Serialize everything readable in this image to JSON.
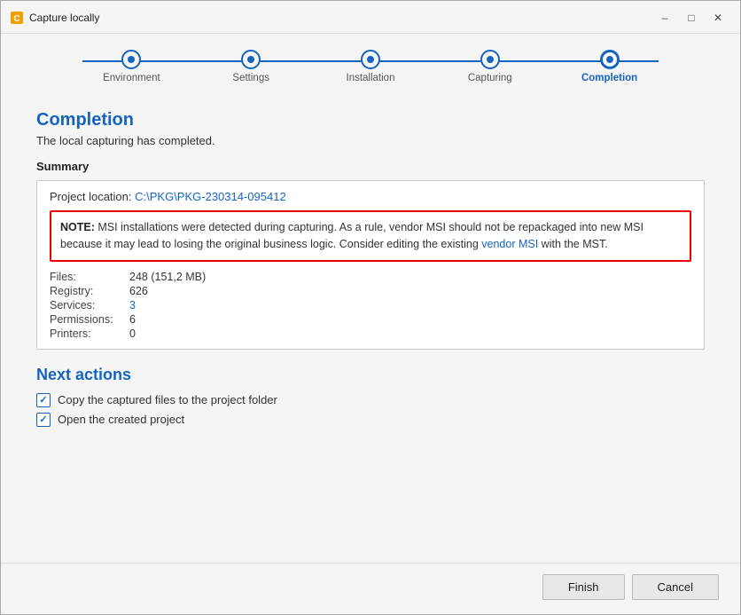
{
  "window": {
    "title": "Capture locally"
  },
  "stepper": {
    "steps": [
      {
        "label": "Environment",
        "active": false
      },
      {
        "label": "Settings",
        "active": false
      },
      {
        "label": "Installation",
        "active": false
      },
      {
        "label": "Capturing",
        "active": false
      },
      {
        "label": "Completion",
        "active": true
      }
    ]
  },
  "page": {
    "title": "Completion",
    "subtitle": "The local capturing has completed.",
    "summary_label": "Summary",
    "project_location_label": "Project location:",
    "project_location_value": "C:\\PKG\\PKG-230314-095412",
    "warning_note": "NOTE:",
    "warning_text": " MSI installations were detected during capturing. As a rule, vendor MSI should not be repackaged into new MSI because it may lead to losing the original business logic. Consider editing the existing ",
    "warning_link": "vendor MSI",
    "warning_suffix": " with the MST.",
    "stats": [
      {
        "label": "Files:",
        "value": "248 (151,2 MB)",
        "blue": false
      },
      {
        "label": "Registry:",
        "value": "626",
        "blue": false
      },
      {
        "label": "Services:",
        "value": "3",
        "blue": true
      },
      {
        "label": "Permissions:",
        "value": "6",
        "blue": false
      },
      {
        "label": "Printers:",
        "value": "0",
        "blue": false
      }
    ],
    "next_actions_title": "Next actions",
    "checkboxes": [
      {
        "label": "Copy the captured files to the project folder",
        "checked": true
      },
      {
        "label": "Open the created project",
        "checked": true
      }
    ]
  },
  "footer": {
    "finish_label": "Finish",
    "cancel_label": "Cancel"
  }
}
